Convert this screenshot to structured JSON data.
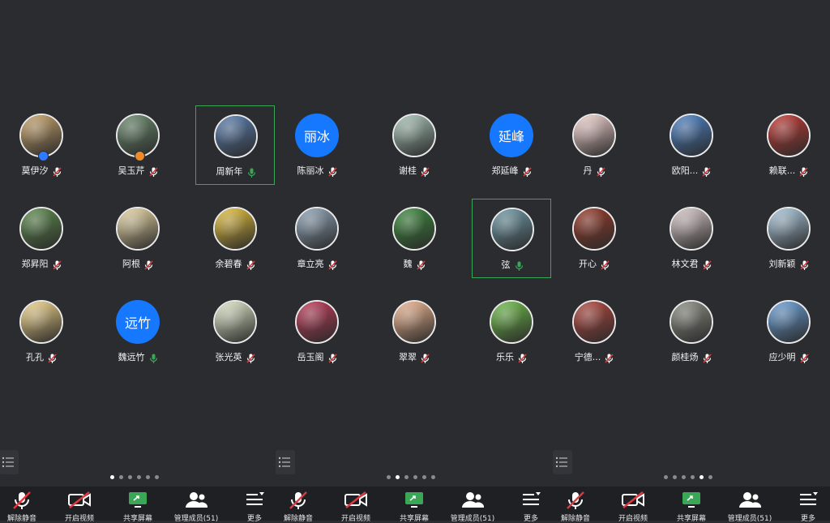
{
  "pages": [
    {
      "active_page_index": 0,
      "participants": [
        {
          "name": "莫伊汐",
          "mic": "muted",
          "avatar": "photo",
          "color": "#c9a46b",
          "badge": "host"
        },
        {
          "name": "吴玉芹",
          "mic": "muted",
          "avatar": "photo",
          "color": "#6b8b6e",
          "badge": "cohost"
        },
        {
          "name": "周新年",
          "mic": "on",
          "avatar": "photo",
          "color": "#5a7fb0",
          "speaking": true
        },
        {
          "name": "陈丽冰",
          "mic": "muted",
          "avatar": "text",
          "text": "丽冰"
        },
        {
          "name": "谢桂",
          "mic": "muted",
          "avatar": "photo",
          "color": "#a8c4b8"
        },
        {
          "name": "郑延峰",
          "mic": "muted",
          "avatar": "text",
          "text": "延峰"
        },
        {
          "name": "丹",
          "mic": "muted",
          "avatar": "photo",
          "color": "#f4d4d0"
        },
        {
          "name": "欧阳...",
          "mic": "muted",
          "avatar": "photo",
          "color": "#4d83c8"
        },
        {
          "name": "赖联...",
          "mic": "muted",
          "avatar": "photo",
          "color": "#c33b35"
        },
        {
          "name": "郑昇阳",
          "mic": "muted",
          "avatar": "photo",
          "color": "#5e8c4e"
        },
        {
          "name": "阿根",
          "mic": "muted",
          "avatar": "photo",
          "color": "#e9d7a2"
        },
        {
          "name": "余碧春",
          "mic": "muted",
          "avatar": "photo",
          "color": "#e6c13a"
        },
        {
          "name": "章立亮",
          "mic": "muted",
          "avatar": "photo",
          "color": "#8fa4b8"
        },
        {
          "name": "魏",
          "mic": "muted",
          "avatar": "photo",
          "color": "#3d8b3d"
        },
        {
          "name": "弦",
          "mic": "on",
          "avatar": "photo",
          "color": "#6f9aa8",
          "speaking": true
        },
        {
          "name": "开心",
          "mic": "muted",
          "avatar": "photo",
          "color": "#9a3b2a"
        },
        {
          "name": "林文君",
          "mic": "muted",
          "avatar": "photo",
          "color": "#d9c8c8"
        },
        {
          "name": "刘新颖",
          "mic": "muted",
          "avatar": "photo",
          "color": "#a9c7dc"
        },
        {
          "name": "孔孔",
          "mic": "muted",
          "avatar": "photo",
          "color": "#f2d58a"
        },
        {
          "name": "魏远竹",
          "mic": "on",
          "avatar": "text",
          "text": "远竹"
        },
        {
          "name": "张光英",
          "mic": "muted",
          "avatar": "photo",
          "color": "#dfe8c8"
        },
        {
          "name": "岳玉阁",
          "mic": "muted",
          "avatar": "photo",
          "color": "#c23c5a"
        },
        {
          "name": "翠翠",
          "mic": "muted",
          "avatar": "photo",
          "color": "#f0b58f"
        },
        {
          "name": "乐乐",
          "mic": "muted",
          "avatar": "photo",
          "color": "#6fbf4a"
        },
        {
          "name": "宁德...",
          "mic": "muted",
          "avatar": "photo",
          "color": "#b5483f"
        },
        {
          "name": "颜桂炀",
          "mic": "muted",
          "avatar": "photo",
          "color": "#8d8f84"
        },
        {
          "name": "应少明",
          "mic": "muted",
          "avatar": "photo",
          "color": "#6aa0d9"
        }
      ]
    }
  ],
  "page_indicator": {
    "count": 6
  },
  "toolbar": {
    "unmute_label": "解除静音",
    "start_video_label": "开启视频",
    "share_screen_label": "共享屏幕",
    "manage_members_label": "管理成员(51)",
    "more_label": "更多"
  },
  "colors": {
    "background": "#2b2c30",
    "toolbar": "#1f2023",
    "mic_muted": "#e0393e",
    "mic_on": "#3aa757",
    "avatar_text_bg": "#1677ff",
    "speaking_border": "#3aa757"
  }
}
